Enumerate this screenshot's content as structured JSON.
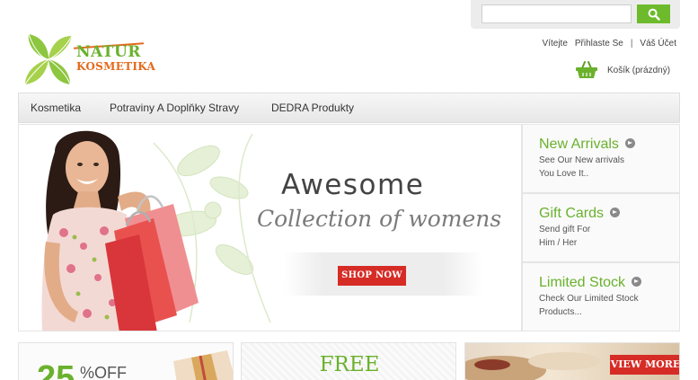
{
  "search": {
    "placeholder": "",
    "button_icon": "search-icon"
  },
  "logo": {
    "word1": "NATUR",
    "word2": "KOSMETIKA"
  },
  "account": {
    "welcome": "Vítejte",
    "login": "Přihlaste Se",
    "separator": "|",
    "my_account": "Váš Účet"
  },
  "cart": {
    "label": "Košík (prázdný)",
    "icon": "basket-icon"
  },
  "nav": {
    "items": [
      "Kosmetika",
      "Potraviny A Doplňky Stravy",
      "DEDRA Produkty"
    ]
  },
  "hero": {
    "title": "Awesome",
    "subtitle": "Collection of womens",
    "button": "SHOP NOW"
  },
  "promos": [
    {
      "title": "New Arrivals",
      "lines": [
        "See Our New arrivals",
        "You Love It.."
      ]
    },
    {
      "title": "Gift Cards",
      "lines": [
        "Send gift For",
        "Him / Her"
      ]
    },
    {
      "title": "Limited Stock",
      "lines": [
        "Check Our Limited Stock",
        "Products..."
      ]
    }
  ],
  "banners": {
    "discount_number": "25",
    "discount_suffix": "%OFF",
    "free": "FREE",
    "view_more": "VIEW MORE"
  },
  "colors": {
    "brand_green": "#6ab12d",
    "accent_red": "#d62c26",
    "logo_orange": "#e46a1c"
  }
}
